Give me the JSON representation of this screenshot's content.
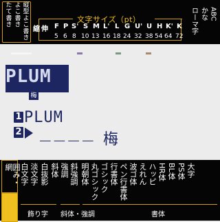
{
  "orientation": {
    "items": [
      "縦型よこ書き",
      "よこ書き",
      "たて書き"
    ]
  },
  "size": {
    "title": "文字サイズ（pt）",
    "shrink": "縮",
    "expand": "伸",
    "letters": [
      "F",
      "P",
      "S",
      "S",
      "M",
      "L",
      "L",
      "G",
      "U",
      "U",
      "H",
      "K",
      "K"
    ],
    "letters_display": [
      "F",
      "P",
      "S'",
      "S",
      "M",
      "L'",
      "L",
      "G",
      "U'",
      "U",
      "H",
      "K'",
      "K"
    ],
    "values": [
      "5",
      "6",
      "8",
      "10",
      "13",
      "16",
      "18",
      "24",
      "32",
      "38",
      "54",
      "64",
      "72"
    ]
  },
  "modes": {
    "items": [
      "ローマ字",
      "かな",
      "ABC"
    ]
  },
  "preview": {
    "logo_text": "PLUM",
    "sub_text": "梅",
    "line1_badge": "1",
    "line1_text": "PLUM",
    "line2_badge": "2",
    "line2_text": "____",
    "line2_kanji": "梅"
  },
  "styles": {
    "frame_btn": "囲み・網",
    "frame_btn2": "",
    "columns": [
      "白文字",
      "淡文字",
      "白抜影",
      "斜体",
      "強調",
      "斜強調",
      "明朝体",
      "丸ゴシック",
      "ゴシック",
      "行書体",
      "ペン行書体",
      "波ゴ体",
      "えれん",
      "ハッピ",
      "HR体",
      "BL体",
      "PS体",
      "大字"
    ],
    "group_labels": [
      "飾り字",
      "斜体・強調",
      "書体"
    ]
  },
  "colors": {
    "panel": "#050505",
    "accent": "#d2a10a",
    "preview_navy": "#1d2660",
    "background": "#ececec"
  }
}
